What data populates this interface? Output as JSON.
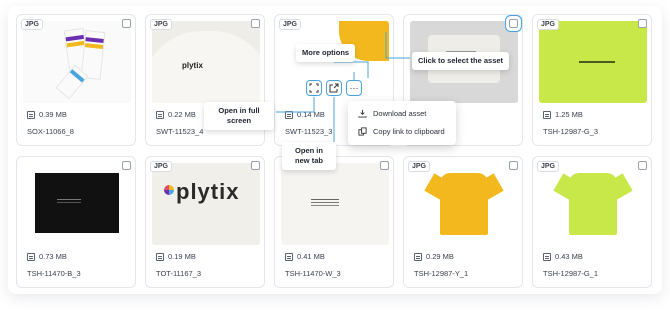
{
  "assets": [
    {
      "format": "JPG",
      "size": "0.39 MB",
      "name": "SOX-11066_8",
      "image": "socks"
    },
    {
      "format": "JPG",
      "size": "0.22 MB",
      "name": "SWT-11523_4",
      "image": "white-sweatshirt-plytix"
    },
    {
      "format": "JPG",
      "size": "0.14 MB",
      "name": "SWT-11523_3",
      "image": "yellow-sweatshirt"
    },
    {
      "format": "",
      "size": "",
      "name": "",
      "image": "folded-shirt"
    },
    {
      "format": "JPG",
      "size": "1.25 MB",
      "name": "TSH-12987-G_3",
      "image": "lime-shirt-closeup"
    },
    {
      "format": "JPG",
      "size": "0.73 MB",
      "name": "TSH-11470-B_3",
      "image": "black-shirt"
    },
    {
      "format": "JPG",
      "size": "0.19 MB",
      "name": "TOT-11167_3",
      "image": "plytix-tote"
    },
    {
      "format": "JPG",
      "size": "0.41 MB",
      "name": "TSH-11470-W_3",
      "image": "white-shirt-print"
    },
    {
      "format": "JPG",
      "size": "0.29 MB",
      "name": "TSH-12987-Y_1",
      "image": "yellow-tshirt"
    },
    {
      "format": "JPG",
      "size": "0.43 MB",
      "name": "TSH-12987-G_1",
      "image": "lime-tshirt"
    }
  ],
  "thumb_text": {
    "plytix_small": "plytix",
    "plytix_big": "plytix"
  },
  "callouts": {
    "more_options": "More options",
    "select_asset": "Click to select the asset",
    "full_screen": "Open in full screen",
    "new_tab": "Open in new tab"
  },
  "menu": {
    "download": "Download asset",
    "copy_link": "Copy link to clipboard"
  },
  "actions": {
    "more_glyph": "···",
    "fullscreen_icon": "fullscreen-icon",
    "newtab_icon": "external-link-icon"
  },
  "colors": {
    "accent": "#4aa4de",
    "lime": "#c8e84a",
    "yellow": "#f2b81d"
  }
}
